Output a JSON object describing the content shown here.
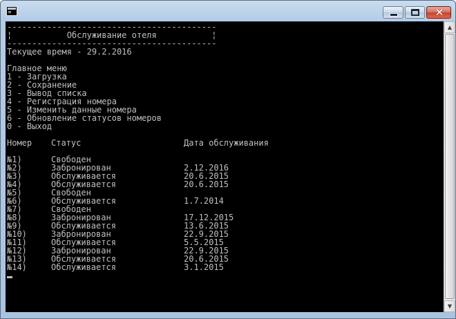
{
  "window": {
    "title": ""
  },
  "console": {
    "border_top": "------------------------------------------",
    "header_title": "¦           Обслуживание отеля           ¦",
    "border_bottom": "------------------------------------------",
    "current_time": "Текущее время - 29.2.2016",
    "menu_title": "Главное меню",
    "menu_items": [
      "1 - Загрузка",
      "2 - Сохранение",
      "3 - Вывод списка",
      "4 - Регистрация номера",
      "5 - Изменить данные номера",
      "6 - Обновление статусов номеров",
      "0 - Выход"
    ],
    "table": {
      "headers": {
        "number": "Номер",
        "status": "Статус",
        "date": "Дата обслуживания"
      },
      "rows": [
        {
          "number": "№1)",
          "status": "Свободен",
          "date": ""
        },
        {
          "number": "№2)",
          "status": "Забронирован",
          "date": "2.12.2016"
        },
        {
          "number": "№3)",
          "status": "Обслуживается",
          "date": "20.6.2015"
        },
        {
          "number": "№4)",
          "status": "Обслуживается",
          "date": "20.6.2015"
        },
        {
          "number": "№5)",
          "status": "Свободен",
          "date": ""
        },
        {
          "number": "№6)",
          "status": "Обслуживается",
          "date": "1.7.2014"
        },
        {
          "number": "№7)",
          "status": "Свободен",
          "date": ""
        },
        {
          "number": "№8)",
          "status": "Забронирован",
          "date": "17.12.2015"
        },
        {
          "number": "№9)",
          "status": "Обслуживается",
          "date": "13.6.2015"
        },
        {
          "number": "№10)",
          "status": "Забронирован",
          "date": "22.9.2015"
        },
        {
          "number": "№11)",
          "status": "Обслуживается",
          "date": "5.5.2015"
        },
        {
          "number": "№12)",
          "status": "Забронирован",
          "date": "22.9.2015"
        },
        {
          "number": "№13)",
          "status": "Обслуживается",
          "date": "20.6.2015"
        },
        {
          "number": "№14)",
          "status": "Обслуживается",
          "date": "3.1.2015"
        }
      ]
    }
  }
}
